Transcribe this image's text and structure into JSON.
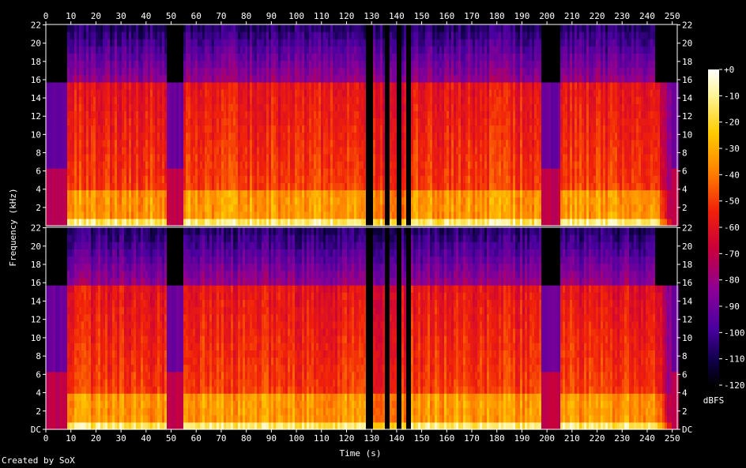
{
  "chart_data": {
    "type": "heatmap",
    "title": "",
    "xlabel": "Time (s)",
    "ylabel": "Frequency (kHz)",
    "xlim": [
      0,
      252
    ],
    "ylim": [
      0,
      22.05
    ],
    "x_ticks": [
      "0",
      "10",
      "20",
      "30",
      "40",
      "50",
      "60",
      "70",
      "80",
      "90",
      "100",
      "110",
      "120",
      "130",
      "140",
      "150",
      "160",
      "170",
      "180",
      "190",
      "200",
      "210",
      "220",
      "230",
      "240",
      "250"
    ],
    "channels": [
      {
        "y_ticks": [
          "22",
          "20",
          "18",
          "16",
          "14",
          "12",
          "10",
          "8",
          "6",
          "4",
          "2"
        ]
      },
      {
        "y_ticks": [
          "22",
          "20",
          "18",
          "16",
          "14",
          "12",
          "10",
          "8",
          "6",
          "4",
          "2",
          "DC"
        ]
      }
    ],
    "colorbar": {
      "label": "dBFS",
      "range": [
        -120,
        0
      ],
      "ticks": [
        "+0",
        "-10",
        "-20",
        "-30",
        "-40",
        "-50",
        "-60",
        "-70",
        "-80",
        "-90",
        "-100",
        "-110",
        "-120"
      ]
    },
    "segments_s": [
      {
        "from": 0,
        "to": 8,
        "level": "quiet, lowpass 16 kHz"
      },
      {
        "from": 8,
        "to": 48,
        "level": "loud"
      },
      {
        "from": 48,
        "to": 54,
        "level": "quiet"
      },
      {
        "from": 54,
        "to": 127,
        "level": "loud"
      },
      {
        "from": 127,
        "to": 145,
        "level": "sparse bursts"
      },
      {
        "from": 145,
        "to": 197,
        "level": "loud"
      },
      {
        "from": 197,
        "to": 205,
        "level": "quiet, lowpass 16 kHz"
      },
      {
        "from": 205,
        "to": 243,
        "level": "loud"
      },
      {
        "from": 243,
        "to": 252,
        "level": "fade out"
      }
    ],
    "credit": "Created by SoX"
  }
}
